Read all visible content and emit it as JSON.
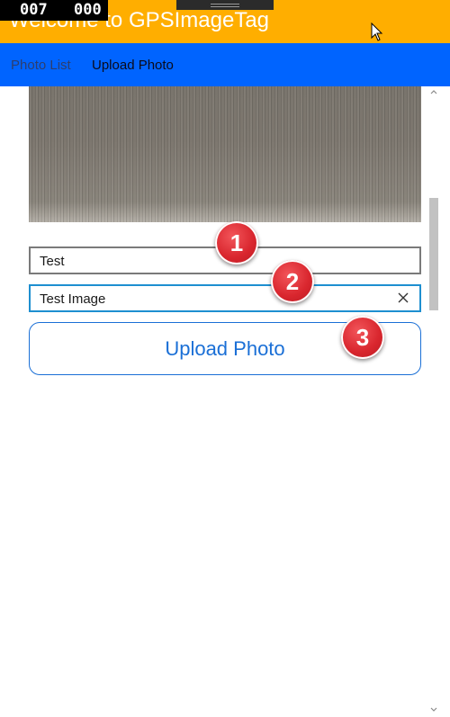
{
  "app": {
    "title": "Welcome to GPSImageTag"
  },
  "debug": {
    "fps_a": "007",
    "fps_b": "000"
  },
  "nav": {
    "items": [
      {
        "label": "Photo List"
      },
      {
        "label": "Upload Photo"
      }
    ]
  },
  "form": {
    "title_value": "Test",
    "description_value": "Test Image",
    "upload_label": "Upload Photo"
  },
  "markers": [
    "1",
    "2",
    "3"
  ],
  "colors": {
    "header": "#ffae00",
    "nav": "#0064ff",
    "accent": "#1a6fd6",
    "focus_border": "#1e8fd0",
    "marker": "#d9262e"
  },
  "icons": {
    "cursor": "mouse-pointer-icon",
    "clear": "close-icon",
    "scroll_up": "chevron-up-icon",
    "scroll_down": "chevron-down-icon"
  }
}
